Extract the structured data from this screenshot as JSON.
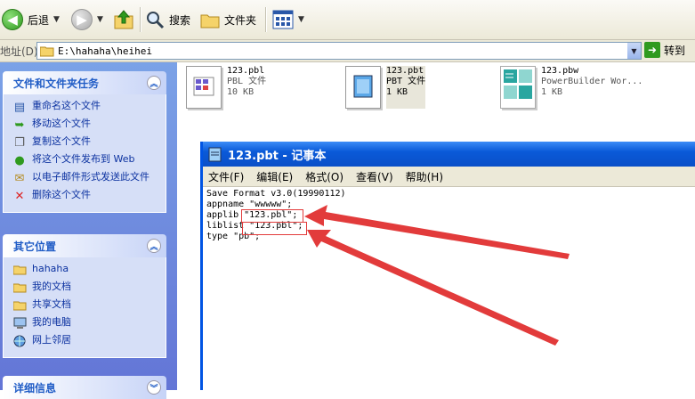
{
  "toolbar": {
    "back_label": "后退",
    "search_label": "搜索",
    "folders_label": "文件夹"
  },
  "address": {
    "label": "地址(D)",
    "path": "E:\\hahaha\\heihei",
    "go_label": "转到"
  },
  "tasks_panel": {
    "title": "文件和文件夹任务",
    "items": [
      {
        "label": "重命名这个文件",
        "icon": "rename-icon"
      },
      {
        "label": "移动这个文件",
        "icon": "move-icon"
      },
      {
        "label": "复制这个文件",
        "icon": "copy-icon"
      },
      {
        "label": "将这个文件发布到 Web",
        "icon": "publish-web-icon"
      },
      {
        "label": "以电子邮件形式发送此文件",
        "icon": "email-icon"
      },
      {
        "label": "删除这个文件",
        "icon": "delete-icon"
      }
    ]
  },
  "places_panel": {
    "title": "其它位置",
    "items": [
      {
        "label": "hahaha",
        "icon": "folder-icon"
      },
      {
        "label": "我的文档",
        "icon": "folder-icon"
      },
      {
        "label": "共享文档",
        "icon": "folder-icon"
      },
      {
        "label": "我的电脑",
        "icon": "computer-icon"
      },
      {
        "label": "网上邻居",
        "icon": "network-icon"
      }
    ]
  },
  "details_panel": {
    "title": "详细信息"
  },
  "files": [
    {
      "name": "123.pbl",
      "type": "PBL 文件",
      "size": "10 KB"
    },
    {
      "name": "123.pbt",
      "type": "PBT 文件",
      "size": "1 KB"
    },
    {
      "name": "123.pbw",
      "type": "PowerBuilder Wor...",
      "size": "1 KB"
    }
  ],
  "notepad": {
    "title": "123.pbt - 记事本",
    "menu": [
      "文件(F)",
      "编辑(E)",
      "格式(O)",
      "查看(V)",
      "帮助(H)"
    ],
    "lines": [
      "Save Format v3.0(19990112)",
      "appname \"wwwww\";",
      "applib \"123.pbl\";",
      "liblist \"123.pbl\";",
      "type \"pb\";"
    ]
  },
  "colors": {
    "annotation_red": "#e23b3b",
    "xp_blue": "#0054e3"
  }
}
